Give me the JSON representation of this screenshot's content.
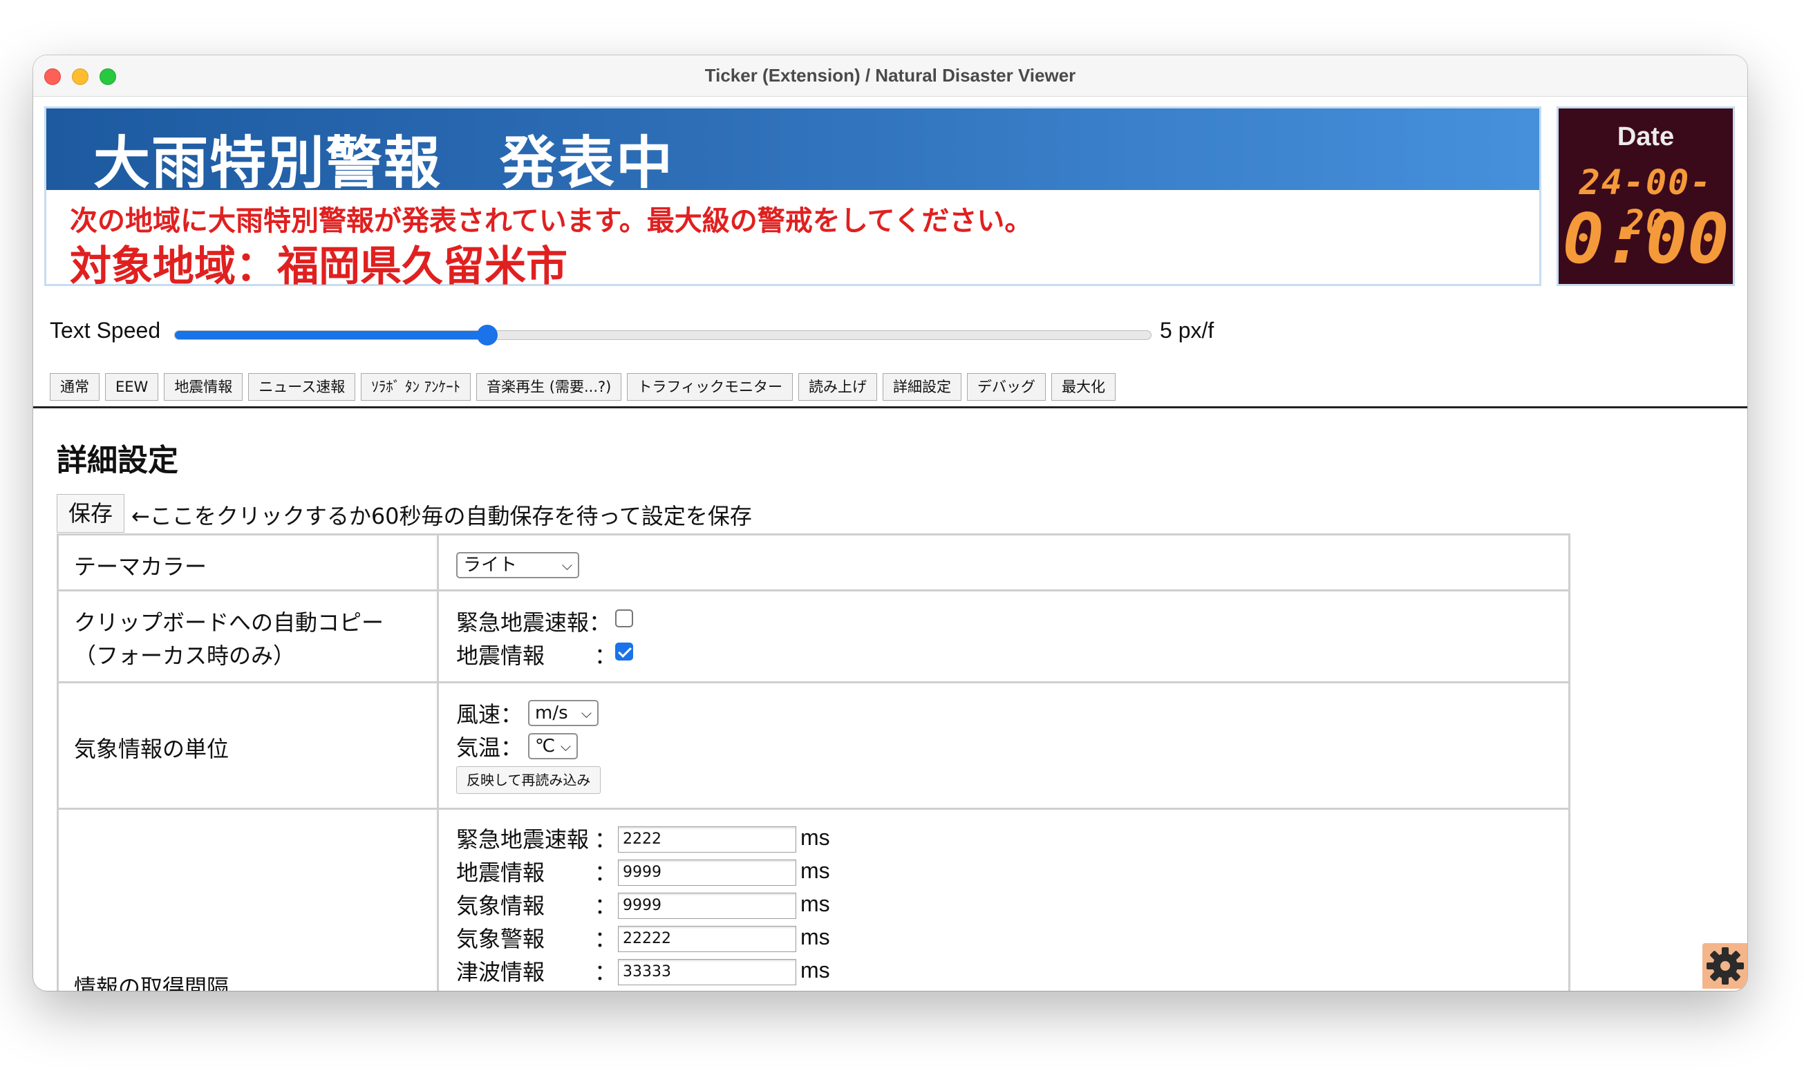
{
  "window": {
    "title": "Ticker (Extension) / Natural Disaster Viewer"
  },
  "ticker": {
    "headline": "大雨特別警報　発表中",
    "message": "次の地域に大雨特別警報が発表されています。最大級の警戒をしてください。",
    "area": "対象地域：福岡県久留米市"
  },
  "clock": {
    "label": "Date",
    "date": "24-00-20",
    "time": "0:00"
  },
  "speed": {
    "label": "Text Speed",
    "value": "5 px/f",
    "fraction": 0.32
  },
  "tabs": [
    "通常",
    "EEW",
    "地震情報",
    "ニュース速報",
    "ｿﾗﾎﾞ ﾀﾝ ｱﾝｹｰﾄ",
    "音楽再生 (需要...?)",
    "トラフィックモニター",
    "読み上げ",
    "詳細設定",
    "デバッグ",
    "最大化"
  ],
  "settings": {
    "title": "詳細設定",
    "save_label": "保存",
    "save_hint": "←ここをクリックするか60秒毎の自動保存を待って設定を保存",
    "theme": {
      "label": "テーマカラー",
      "value": "ライト"
    },
    "clipboard": {
      "label_line1": "クリップボードへの自動コピー",
      "label_line2": "（フォーカス時のみ）",
      "eew_label": "緊急地震速報：",
      "eew_checked": false,
      "quake_label": "地震情報",
      "quake_colon": "：",
      "quake_checked": true
    },
    "units": {
      "label": "気象情報の単位",
      "wind_label": "風速：",
      "wind_value": "m/s",
      "temp_label": "気温：",
      "temp_value": "℃",
      "reload_label": "反映して再読み込み"
    },
    "intervals": {
      "label": "情報の取得間隔",
      "unit": "ms",
      "items": [
        {
          "label": "緊急地震速報",
          "colon": "：",
          "value": "2222"
        },
        {
          "label": "地震情報",
          "colon": "：",
          "value": "9999"
        },
        {
          "label": "気象情報",
          "colon": "：",
          "value": "9999"
        },
        {
          "label": "気象警報",
          "colon": "：",
          "value": "22222"
        },
        {
          "label": "津波情報",
          "colon": "：",
          "value": "33333"
        }
      ]
    }
  },
  "icons": {
    "settings": "gear-icon"
  },
  "colors": {
    "accent": "#1a73e8",
    "alert_red": "#e02020",
    "ticker_blue": "#2e6fb8",
    "clock_bg": "#3b0a1a",
    "clock_digits": "#f59a3a",
    "gear_bg": "#f4b58a"
  }
}
